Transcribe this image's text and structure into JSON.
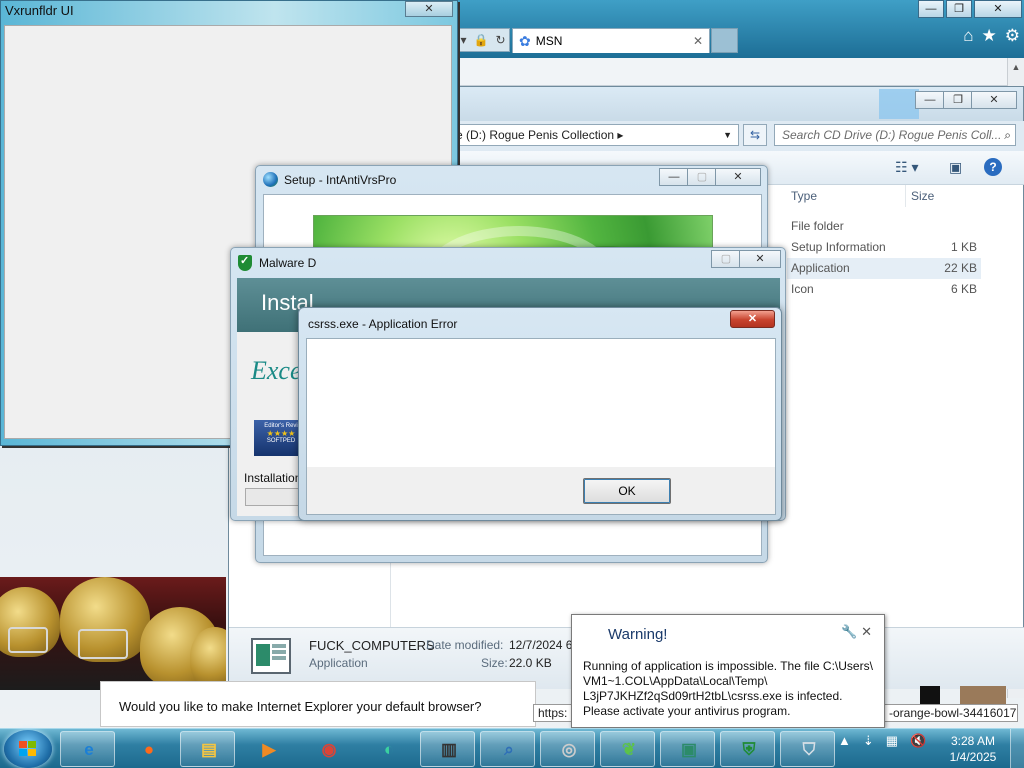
{
  "vxrunfldr": {
    "title": "Vxrunfldr UI",
    "close": "✕"
  },
  "ie": {
    "tab_label": "MSN",
    "tab_close": "✕",
    "window_ctrls": [
      "—",
      "❐",
      "✕"
    ],
    "toolbar_icons": [
      "home-icon",
      "star-icon",
      "gear-icon"
    ]
  },
  "explorer": {
    "path": "e (D:) Rogue Penis Collection",
    "search_placeholder": "Search CD Drive (D:) Rogue Penis Coll...",
    "columns": {
      "type": "Type",
      "size": "Size"
    },
    "files": [
      {
        "type": "File folder",
        "size": ""
      },
      {
        "type": "Setup Information",
        "size": "1 KB"
      },
      {
        "type": "Application",
        "size": "22 KB"
      },
      {
        "type": "Icon",
        "size": "6 KB"
      }
    ],
    "details": {
      "name": "FUCK_COMPUTERS",
      "kind": "Application",
      "date_label": "Date modified:",
      "date_value": "12/7/2024 6",
      "size_label": "Size:",
      "size_value": "22.0 KB"
    }
  },
  "setup": {
    "title": "Setup - IntAntiVrsPro"
  },
  "malware": {
    "title": "Malware D",
    "header": "Instal",
    "big_text": "Exce",
    "badge_top": "Editor's Revi",
    "badge_mid": "SOFTPED",
    "installation_label": "Installation"
  },
  "error_dialog": {
    "title": "csrss.exe - Application Error",
    "ok_label": "OK"
  },
  "ie_default_bar": {
    "text": "Would you like to make Internet Explorer your default browser?"
  },
  "tooltips": {
    "left": "https:",
    "right": "-orange-bowl-34416017"
  },
  "warning": {
    "title": "Warning!",
    "lines": [
      "Running of application is impossible. The file C:\\Users\\",
      "VM1~1.COL\\AppData\\Local\\Temp\\",
      "L3jP7JKHZf2qSd09rtH2tbL\\csrss.exe is infected.",
      "Please activate your antivirus program."
    ]
  },
  "taskbar": {
    "items": [
      "ie-icon",
      "firefox-icon",
      "explorer-icon",
      "media-player-icon",
      "chrome-icon",
      "edge-icon",
      "notepad-icon",
      "search-icon",
      "cd-icon",
      "leaf-icon",
      "app-window-icon",
      "defender-icon",
      "shield-icon"
    ],
    "time": "3:28 AM",
    "date": "1/4/2025"
  },
  "colors": {
    "error_close": "#c8432e",
    "toast_title": "#1a3a6a",
    "taskbar": "#2f7fa3"
  }
}
